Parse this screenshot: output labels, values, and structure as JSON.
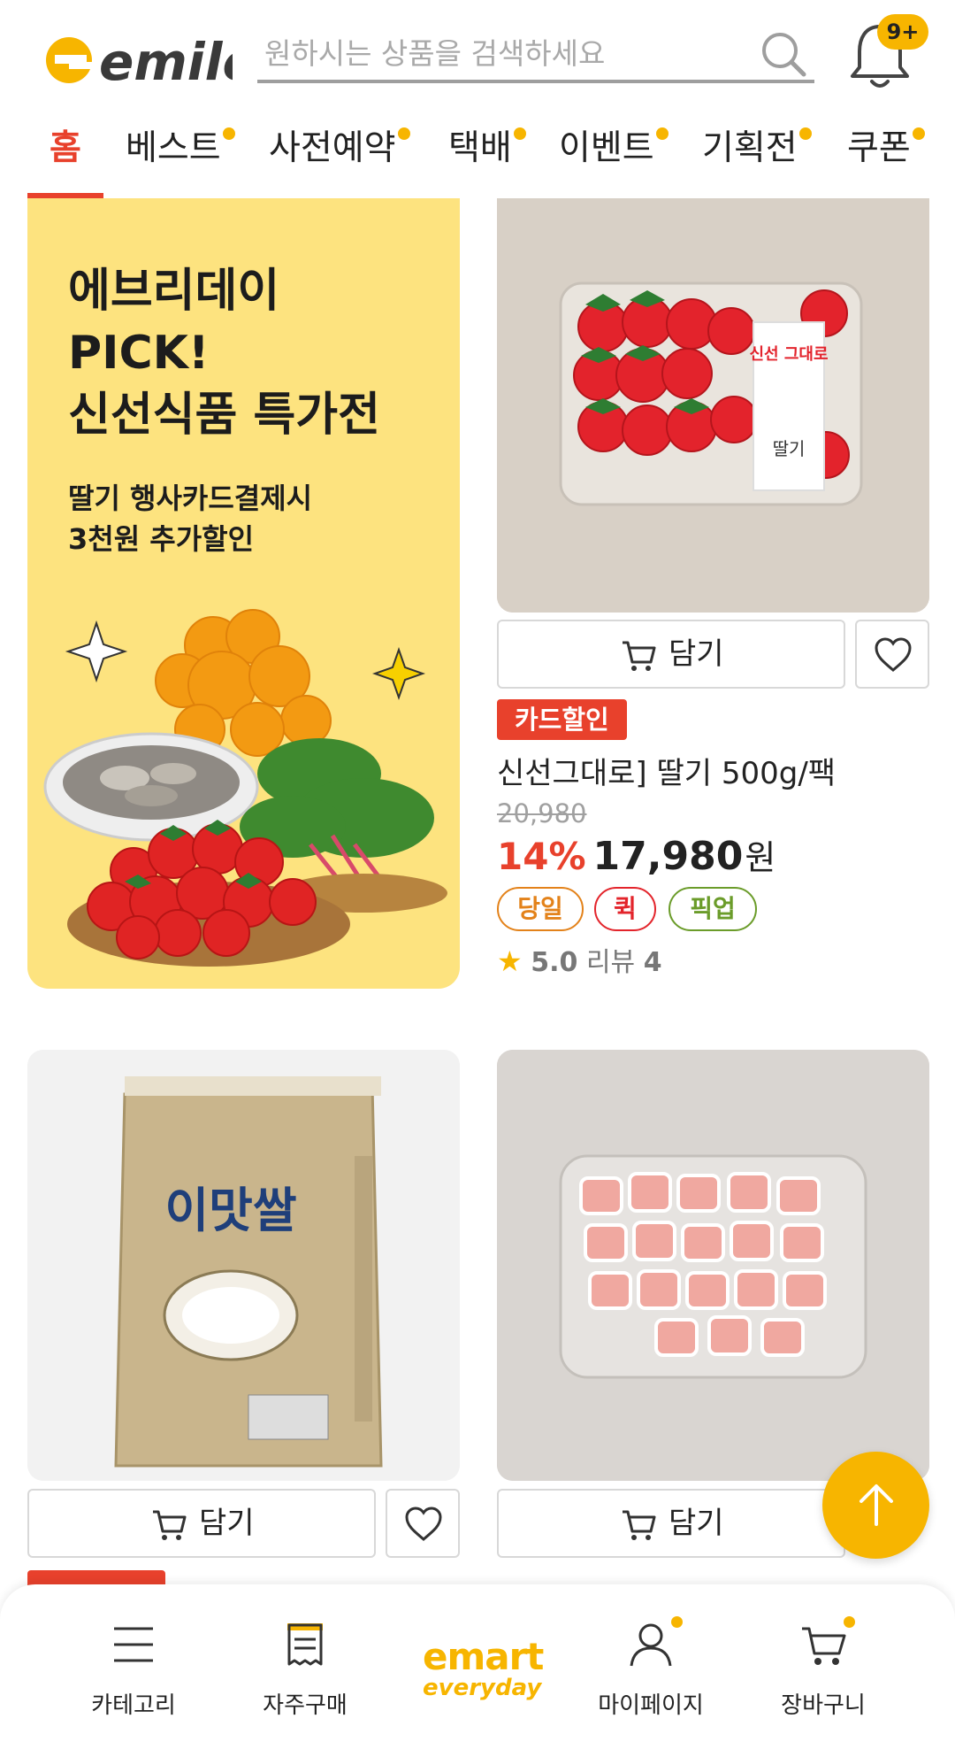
{
  "header": {
    "logo_text": "emile",
    "search_placeholder": "원하시는 상품을 검색하세요",
    "notification_badge": "9+",
    "accent_color": "#f7b500"
  },
  "tabs": [
    {
      "label": "홈",
      "active": true,
      "dot": false
    },
    {
      "label": "베스트",
      "active": false,
      "dot": true
    },
    {
      "label": "사전예약",
      "active": false,
      "dot": true
    },
    {
      "label": "택배",
      "active": false,
      "dot": true
    },
    {
      "label": "이벤트",
      "active": false,
      "dot": true
    },
    {
      "label": "기획전",
      "active": false,
      "dot": true
    },
    {
      "label": "쿠폰",
      "active": false,
      "dot": true
    }
  ],
  "promo": {
    "title": "에브리데이\nPICK!\n신선식품 특가전",
    "subtitle": "딸기 행사카드결제시\n3천원 추가할인"
  },
  "products": [
    {
      "image": "strawberry-pack",
      "cart_label": "담기",
      "badge": "카드할인",
      "name": "신선그대로] 딸기 500g/팩",
      "original_price": "20,980",
      "discount": "14%",
      "price": "17,980",
      "currency": "원",
      "chips": [
        "당일",
        "퀵",
        "픽업"
      ],
      "rating": "5.0",
      "review_label": "리뷰",
      "review_count": "4",
      "pack_label_1": "신선\n그대로",
      "pack_label_2": "딸기"
    },
    {
      "image": "rice-bag",
      "cart_label": "담기",
      "bag_text": "이맛쌀"
    },
    {
      "image": "pork-pack",
      "cart_label": "담기"
    }
  ],
  "bottom_nav": [
    {
      "label": "카테고리",
      "icon": "menu-icon"
    },
    {
      "label": "자주구매",
      "icon": "receipt-icon"
    },
    {
      "label": "emart",
      "icon": "emart-logo",
      "sub": "everyday"
    },
    {
      "label": "마이페이지",
      "icon": "person-icon"
    },
    {
      "label": "장바구니",
      "icon": "cart-icon"
    }
  ]
}
